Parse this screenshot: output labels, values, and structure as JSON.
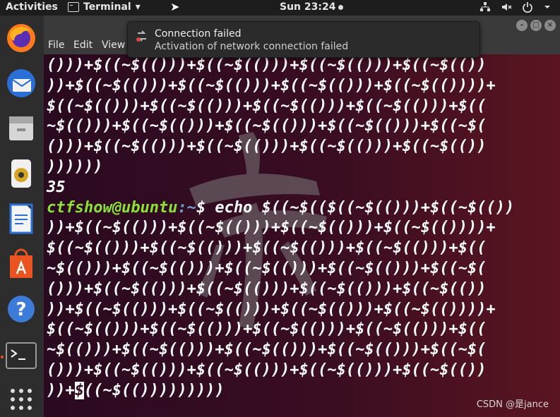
{
  "topbar": {
    "activities": "Activities",
    "app_name": "Terminal",
    "app_arrow": "▾",
    "clock": "Sun 23:24",
    "tray_icons": [
      "network-icon",
      "volume-muted-icon",
      "power-icon",
      "chevron-down-icon"
    ]
  },
  "dock": {
    "items": [
      "firefox-icon",
      "thunderbird-icon",
      "files-icon",
      "rhythmbox-icon",
      "libreoffice-writer-icon",
      "software-center-icon",
      "help-icon",
      "terminal-icon",
      "app-grid-icon"
    ]
  },
  "window": {
    "menu": {
      "file": "File",
      "edit": "Edit",
      "view": "View"
    }
  },
  "notification": {
    "title": "Connection failed",
    "body": "Activation of network connection failed"
  },
  "terminal": {
    "lines": [
      "()))+$((~$(()))+$((~$(()))+$((~$(()))+$((~$(())",
      "))+$((~$(()))+$((~$(()))+$((~$(()))+$((~$(())))+",
      "$((~$(()))+$((~$(()))+$((~$(()))+$((~$(()))+$((",
      "~$(()))+$((~$(()))+$((~$(()))+$((~$(()))+$((~$(",
      "()))+$((~$(()))+$((~$(()))+$((~$(()))+$((~$(())",
      "))))))",
      "35"
    ],
    "prompt_user": "ctfshow@ubuntu",
    "prompt_path": ":~",
    "prompt_sign": "$",
    "command_first": " echo $((~$(($((~$(()))+$((~$(())",
    "command_lines": [
      "))+$((~$(()))+$((~$(()))+$((~$(()))+$((~$(())))+",
      "$((~$(()))+$((~$(()))+$((~$(()))+$((~$(()))+$((",
      "~$(()))+$((~$(()))+$((~$(()))+$((~$(()))+$((~$(",
      "()))+$((~$(()))+$((~$(()))+$((~$(()))+$((~$(())",
      "))+$((~$(()))+$((~$(()))+$((~$(()))+$((~$(())))+",
      "$((~$(()))+$((~$(()))+$((~$(()))+$((~$(()))+$((",
      "~$(()))+$((~$(()))+$((~$(()))+$((~$(()))+$((~$(",
      "()))+$((~$(()))+$((~$(()))+$((~$(()))+$((~$(())"
    ],
    "last_pre": "))+",
    "last_cursor": "$",
    "last_post": "((~$(()))))))))"
  },
  "watermark_text": "CSDN @是jance",
  "colors": {
    "prompt_user": "#8ae234",
    "prompt_path": "#729fcf",
    "terminal_bg": "#300a24",
    "accent": "#e95420"
  }
}
